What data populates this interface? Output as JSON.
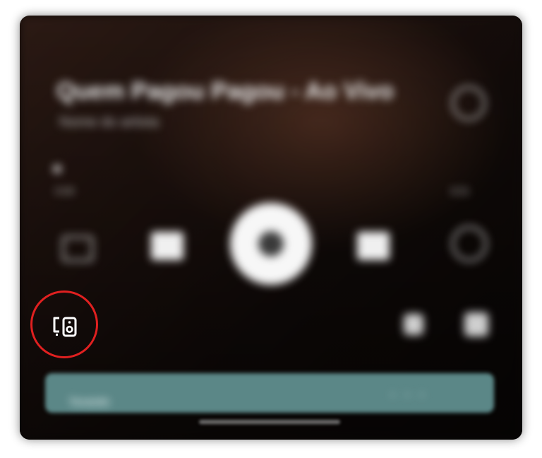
{
  "player": {
    "track_title": "Quem Pagou Pagou - Ao Vivo",
    "artist": "Nome do artista",
    "elapsed": "0:00",
    "duration": "3:21",
    "up_next_label": "Tocando",
    "up_next_meta": "• • •"
  },
  "icons": {
    "favorite": "heart-outline-icon",
    "queue": "queue-icon",
    "previous": "skip-previous-icon",
    "play": "play-icon",
    "next": "skip-next-icon",
    "repeat": "repeat-icon",
    "volume": "volume-icon",
    "more": "more-icon",
    "devices": "devices-icon"
  },
  "colors": {
    "highlight_ring": "#e02020",
    "up_next_bar": "#5b8787"
  }
}
